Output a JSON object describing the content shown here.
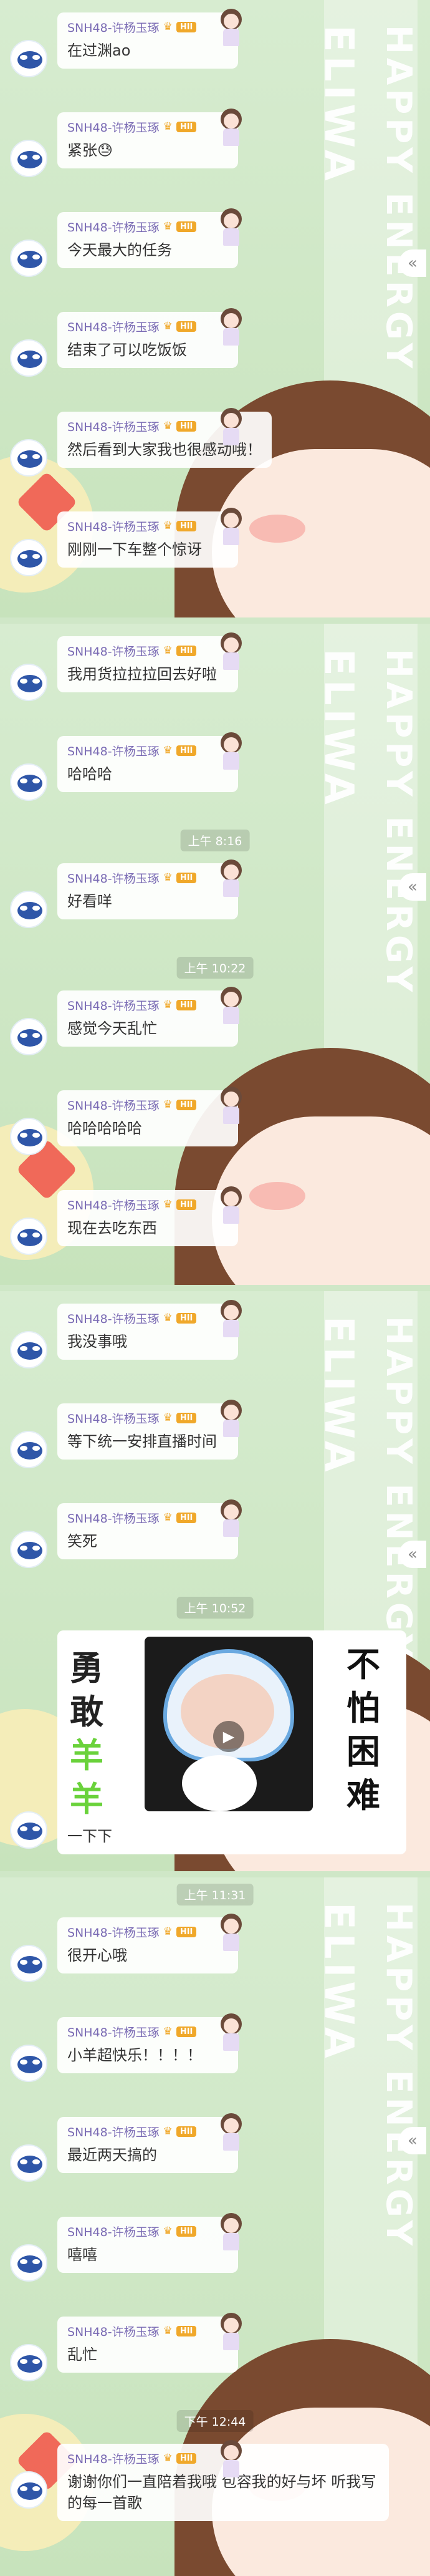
{
  "sender": {
    "name": "SNH48-许杨玉琢",
    "crown": "♛",
    "badge": "HII"
  },
  "decor": {
    "line1": "ELIWA",
    "line2": "HAPPY ENERGY",
    "collapse_glyph": "«"
  },
  "panels": [
    {
      "messages": [
        {
          "text": "在过渊ao"
        },
        {
          "text": "紧张😓"
        },
        {
          "text": "今天最大的任务"
        },
        {
          "text": "结束了可以吃饭饭"
        },
        {
          "text": "然后看到大家我也很感动哦！"
        },
        {
          "text": "刚刚一下车整个惊讶"
        }
      ]
    },
    {
      "messages": [
        {
          "text": "我用货拉拉拉回去好啦"
        },
        {
          "text": "哈哈哈"
        },
        {
          "time": "上午 8:16",
          "text": "好看咩"
        },
        {
          "time": "上午 10:22",
          "text": "感觉今天乱忙"
        },
        {
          "text": "哈哈哈哈哈"
        },
        {
          "text": "现在去吃东西"
        }
      ]
    },
    {
      "messages": [
        {
          "text": "我没事哦"
        },
        {
          "text": "等下统一安排直播时间"
        },
        {
          "text": "笑死"
        }
      ],
      "time_before_image": "上午 10:52",
      "image": {
        "left_chars": [
          "勇",
          "敢",
          "羊",
          "羊"
        ],
        "right_chars": [
          "不",
          "怕",
          "困",
          "难"
        ],
        "camera_icon": "▶",
        "caption": "一下下"
      }
    },
    {
      "messages": [
        {
          "time": "上午 11:31",
          "text": "很开心哦"
        },
        {
          "text": "小羊超快乐！！！！"
        },
        {
          "text": "最近两天搞的"
        },
        {
          "text": "嘻嘻"
        },
        {
          "text": "乱忙"
        },
        {
          "time": "下午 12:44",
          "text": "谢谢你们一直陪着我哦 包容我的好与坏 听我写的每一首歌",
          "wrap": true
        }
      ]
    }
  ]
}
